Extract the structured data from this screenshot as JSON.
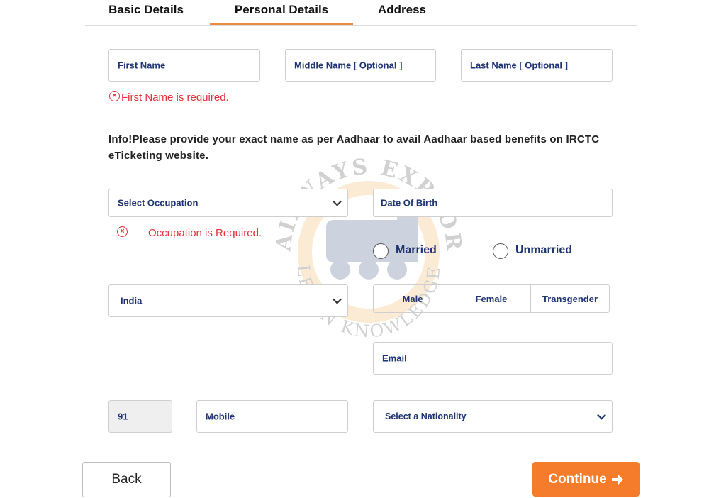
{
  "tabs": [
    {
      "label": "Basic Details"
    },
    {
      "label": "Personal Details"
    },
    {
      "label": "Address"
    }
  ],
  "name_fields": {
    "first_name": "First Name",
    "middle_name": "Middle Name  [ Optional ]",
    "last_name": "Last Name  [ Optional ]"
  },
  "errors": {
    "first_name": "First Name is required.",
    "occupation": "Occupation is Required."
  },
  "info_text": "Info!Please provide your exact name as per Aadhaar to avail Aadhaar based benefits on IRCTC eTicketing website.",
  "occupation": {
    "placeholder": "Select Occupation"
  },
  "dob": {
    "placeholder": "Date Of Birth"
  },
  "marital": {
    "married": "Married",
    "unmarried": "Unmarried"
  },
  "country": {
    "value": "India"
  },
  "gender": {
    "male": "Male",
    "female": "Female",
    "transgender": "Transgender"
  },
  "email": {
    "placeholder": "Email"
  },
  "phone": {
    "code": "91",
    "mobile_placeholder": "Mobile"
  },
  "nationality": {
    "placeholder": "Select a Nationality"
  },
  "buttons": {
    "back": "Back",
    "continue": "Continue"
  },
  "watermark": {
    "top": "RAILWAYS EXPLORE",
    "bottom": "LEARN KNOWLEDGE"
  },
  "colors": {
    "accent": "#f57c2a",
    "error": "#e0303a",
    "label": "#1e3370"
  }
}
